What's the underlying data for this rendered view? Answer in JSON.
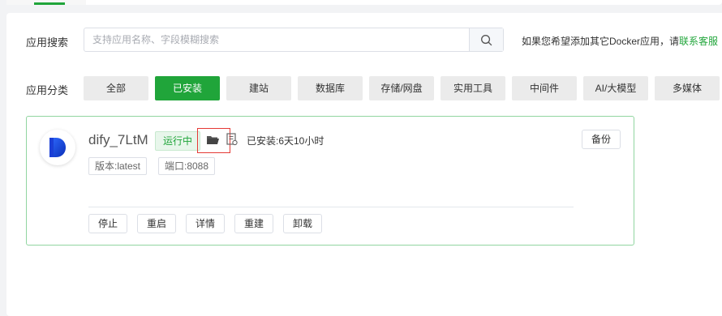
{
  "search": {
    "label": "应用搜索",
    "placeholder": "支持应用名称、字段模糊搜索"
  },
  "hint": {
    "prefix": "如果您希望添加其它Docker应用，请",
    "link": "联系客服"
  },
  "categories": {
    "label": "应用分类",
    "items": [
      {
        "label": "全部",
        "active": false
      },
      {
        "label": "已安装",
        "active": true
      },
      {
        "label": "建站",
        "active": false
      },
      {
        "label": "数据库",
        "active": false
      },
      {
        "label": "存储/网盘",
        "active": false
      },
      {
        "label": "实用工具",
        "active": false
      },
      {
        "label": "中间件",
        "active": false
      },
      {
        "label": "AI/大模型",
        "active": false
      },
      {
        "label": "多媒体",
        "active": false
      }
    ]
  },
  "app": {
    "name": "dify_7LtM",
    "status": "运行中",
    "installed": "已安装:6天10小时",
    "version": "版本:latest",
    "port": "端口:8088",
    "backup_label": "备份",
    "actions": [
      "停止",
      "重启",
      "详情",
      "重建",
      "卸载"
    ]
  },
  "colors": {
    "accent": "#20a53a",
    "card_border": "#91d5a0",
    "highlight": "#e53935"
  },
  "icons": {
    "search": "search-icon",
    "folder": "folder-icon",
    "log": "log-file-icon",
    "logo": "dify-logo"
  }
}
